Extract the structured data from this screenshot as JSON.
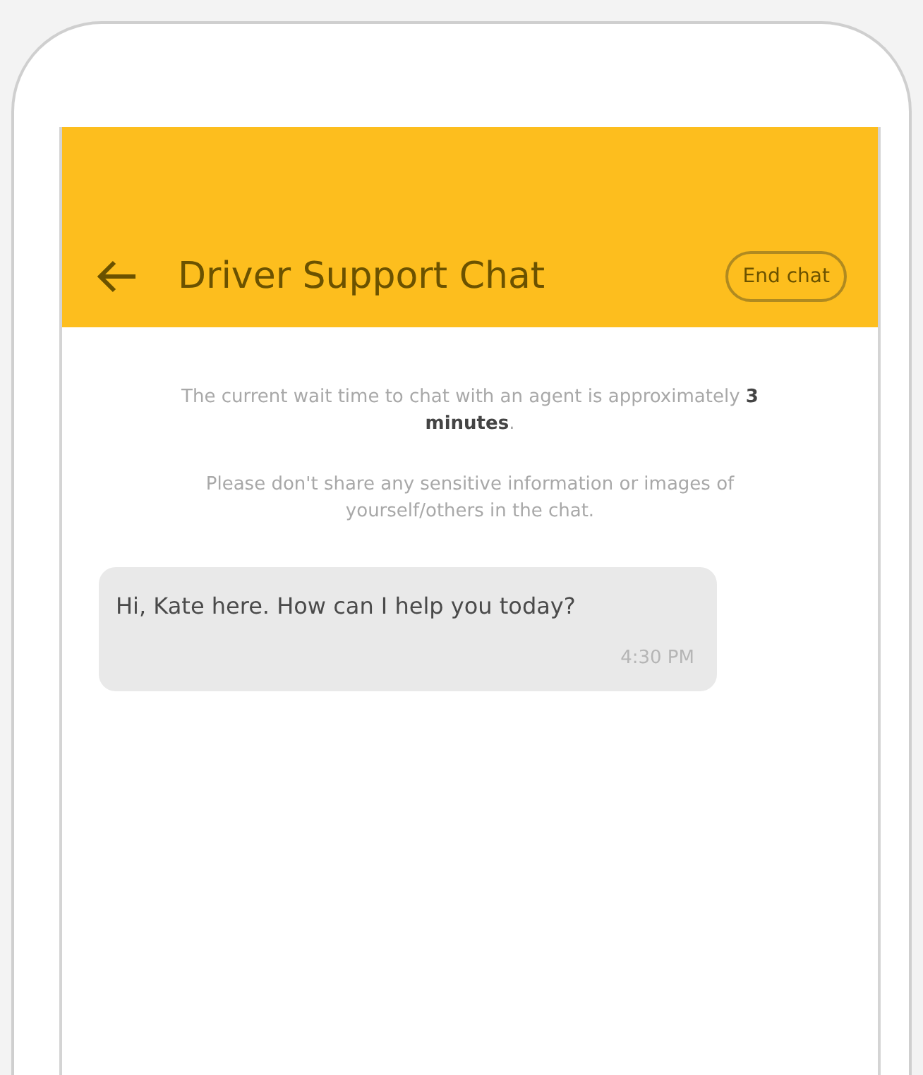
{
  "header": {
    "title": "Driver Support Chat",
    "end_button": "End chat"
  },
  "notices": [
    "The current wait time to chat with an agent is approximately **3 minutes**.",
    "Please don't share any sensitive information or images of yourself/others in the chat."
  ],
  "messages": [
    {
      "text": "Hi, Kate here. How can I help you today?",
      "time": "4:30 PM"
    }
  ]
}
